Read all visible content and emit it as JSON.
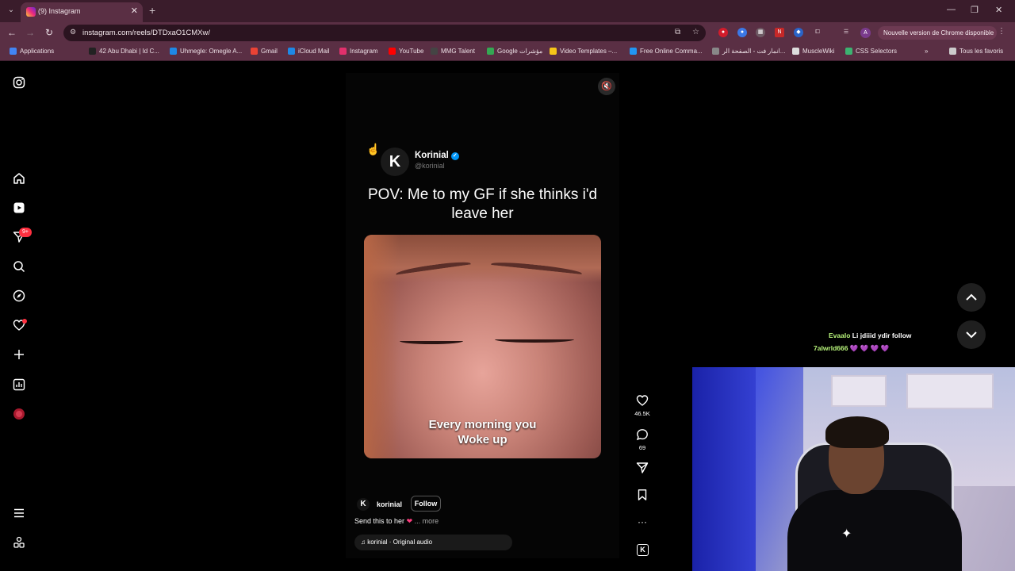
{
  "browser": {
    "tab_title": "(9) Instagram",
    "url": "instagram.com/reels/DTDxaO1CMXw/",
    "profile_initial": "A",
    "update_label": "Nouvelle version de Chrome disponible"
  },
  "bookmarks": [
    {
      "label": "Applications",
      "color": "#4285f4"
    },
    {
      "label": "42 Abu Dhabi | Id C...",
      "color": "#222222"
    },
    {
      "label": "Uhmegle: Omegle A...",
      "color": "#1e88e5"
    },
    {
      "label": "Gmail",
      "color": "#ea4335"
    },
    {
      "label": "iCloud Mail",
      "color": "#1e88e5"
    },
    {
      "label": "Instagram",
      "color": "#e1306c"
    },
    {
      "label": "YouTube",
      "color": "#ff0000"
    },
    {
      "label": "MMG Talent",
      "color": "#444444"
    },
    {
      "label": "Google مؤشرات",
      "color": "#34a853"
    },
    {
      "label": "Video Templates –...",
      "color": "#f5c518"
    },
    {
      "label": "Free Online Comma...",
      "color": "#2196f3"
    },
    {
      "label": "انمار فت - الصفحة الر...",
      "color": "#888888"
    },
    {
      "label": "MuscleWiki",
      "color": "#dddddd"
    },
    {
      "label": "CSS Selectors",
      "color": "#3cb371"
    },
    {
      "label": "Tous les favoris",
      "color": "#cccccc"
    }
  ],
  "sidebar": {
    "notification_badge": "9+"
  },
  "reel": {
    "post_name": "Korinial",
    "post_handle": "@korinial",
    "post_logo": "K",
    "pov_text": "POV: Me to my GF if she thinks i'd leave her",
    "video_caption_line1": "Every morning you",
    "video_caption_line2": "Woke up",
    "creator": "korinial",
    "follow_label": "Follow",
    "caption": "Send this to her",
    "caption_heart": "❤",
    "more_label": "... more",
    "audio": "korinial · Original audio"
  },
  "actions": {
    "likes": "46.5K",
    "comments": "69",
    "audio_badge": "K"
  },
  "chat": [
    {
      "user": "Evaalo",
      "message": "Li jdiiid ydir follow",
      "emotes": ""
    },
    {
      "user": "7alwrld666",
      "message": "",
      "emotes": "💜 💜 💜 💜"
    }
  ],
  "colors": {
    "chrome_frame": "#5a2f44",
    "instagram_bg": "#000000",
    "verified_blue": "#0095f6",
    "badge_red": "#ff3040",
    "chat_username": "#b7f37a"
  }
}
